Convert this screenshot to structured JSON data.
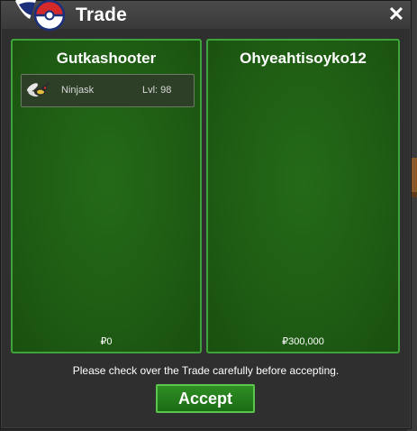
{
  "window": {
    "title": "Trade",
    "close_label": "✕"
  },
  "left_trader": {
    "name": "Gutkashooter",
    "items": [
      {
        "name": "Ninjask",
        "level": "Lvl: 98",
        "icon": "ninjask-icon"
      }
    ],
    "money": "₽0"
  },
  "right_trader": {
    "name": "Ohyeahtisoyko12",
    "items": [],
    "money": "₽300,000"
  },
  "notice": "Please check over the Trade carefully before accepting.",
  "accept_label": "Accept",
  "colors": {
    "panel_green": "#1f5d14",
    "panel_border": "#3ea33a",
    "window_bg": "#2f2f2f"
  }
}
